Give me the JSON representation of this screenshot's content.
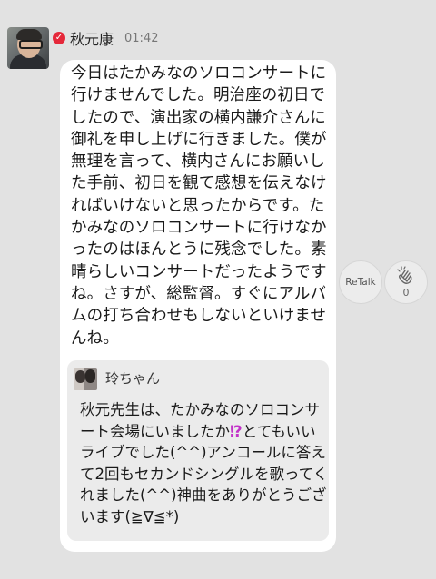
{
  "post": {
    "author": "秋元康",
    "time": "01:42",
    "verified_icon": "check-badge-icon",
    "message": "今日はたかみなのソロコンサートに行けませんでした。明治座の初日でしたので、演出家の横内謙介さんに御礼を申し上げに行きました。僕が無理を言って、横内さんにお願いした手前、初日を観て感想を伝えなければいけないと思ったからです。たかみなのソロコンサートに行けなかったのはほんとうに残念でした。素晴らしいコンサートだったようですね。さすが、総監督。すぐにアルバムの打ち合わせもしないといけませんね。"
  },
  "quote": {
    "author": "玲ちゃん",
    "text_part1": "秋元先生は、たかみなのソロコンサート会場にいましたか",
    "emoji": "⁉",
    "text_part2": "とてもいいライブでした(^^)アンコールに答えて2回もセカンドシングルを歌ってくれました(^^)神曲をありがとうございます(≧∇≦*)"
  },
  "actions": {
    "retalk_label": "ReTalk",
    "clap_icon": "clap-icon",
    "clap_count": "0"
  },
  "colors": {
    "background": "#e2e2e2",
    "bubble": "#ffffff",
    "quote_bg": "#ebebeb",
    "verified": "#e5283a"
  }
}
